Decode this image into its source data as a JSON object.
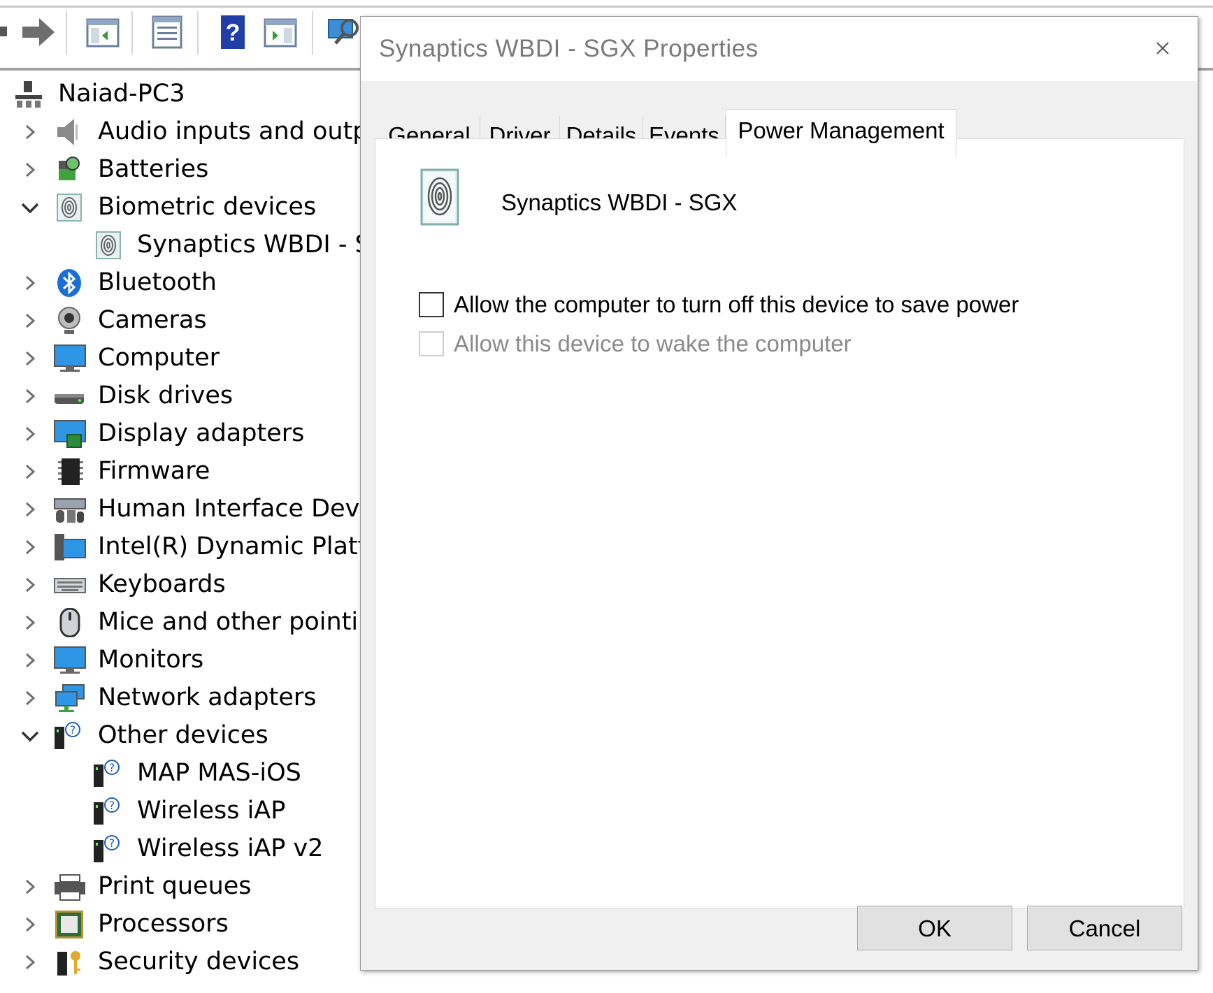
{
  "tree": {
    "root": "Naiad-PC3",
    "items": [
      {
        "label": "Audio inputs and outputs",
        "expanded": false
      },
      {
        "label": "Batteries",
        "expanded": false
      },
      {
        "label": "Biometric devices",
        "expanded": true
      },
      {
        "label": "Synaptics WBDI - SGX",
        "child": true
      },
      {
        "label": "Bluetooth",
        "expanded": false
      },
      {
        "label": "Cameras",
        "expanded": false
      },
      {
        "label": "Computer",
        "expanded": false
      },
      {
        "label": "Disk drives",
        "expanded": false
      },
      {
        "label": "Display adapters",
        "expanded": false
      },
      {
        "label": "Firmware",
        "expanded": false
      },
      {
        "label": "Human Interface Devices",
        "expanded": false
      },
      {
        "label": "Intel(R) Dynamic Platform",
        "expanded": false
      },
      {
        "label": "Keyboards",
        "expanded": false
      },
      {
        "label": "Mice and other pointing",
        "expanded": false
      },
      {
        "label": "Monitors",
        "expanded": false
      },
      {
        "label": "Network adapters",
        "expanded": false
      },
      {
        "label": "Other devices",
        "expanded": true
      },
      {
        "label": "MAP MAS-iOS",
        "child": true
      },
      {
        "label": "Wireless iAP",
        "child": true
      },
      {
        "label": "Wireless iAP v2",
        "child": true
      },
      {
        "label": "Print queues",
        "expanded": false
      },
      {
        "label": "Processors",
        "expanded": false
      },
      {
        "label": "Security devices",
        "expanded": false
      }
    ]
  },
  "dialog": {
    "title": "Synaptics WBDI - SGX Properties",
    "tabs": [
      {
        "label": "General"
      },
      {
        "label": "Driver"
      },
      {
        "label": "Details"
      },
      {
        "label": "Events"
      },
      {
        "label": "Power Management"
      }
    ],
    "active_tab": "Power Management",
    "device_name": "Synaptics WBDI - SGX",
    "options": [
      {
        "label": "Allow the computer to turn off this device to save power",
        "checked": false,
        "enabled": true
      },
      {
        "label": "Allow this device to wake the computer",
        "checked": false,
        "enabled": false
      }
    ],
    "ok_label": "OK",
    "cancel_label": "Cancel"
  },
  "colors": {
    "accent": "#0078d7",
    "dialog_bg": "#f0f0f0",
    "title_text": "#7a7a7a",
    "disabled_text": "#8a8a8a"
  }
}
